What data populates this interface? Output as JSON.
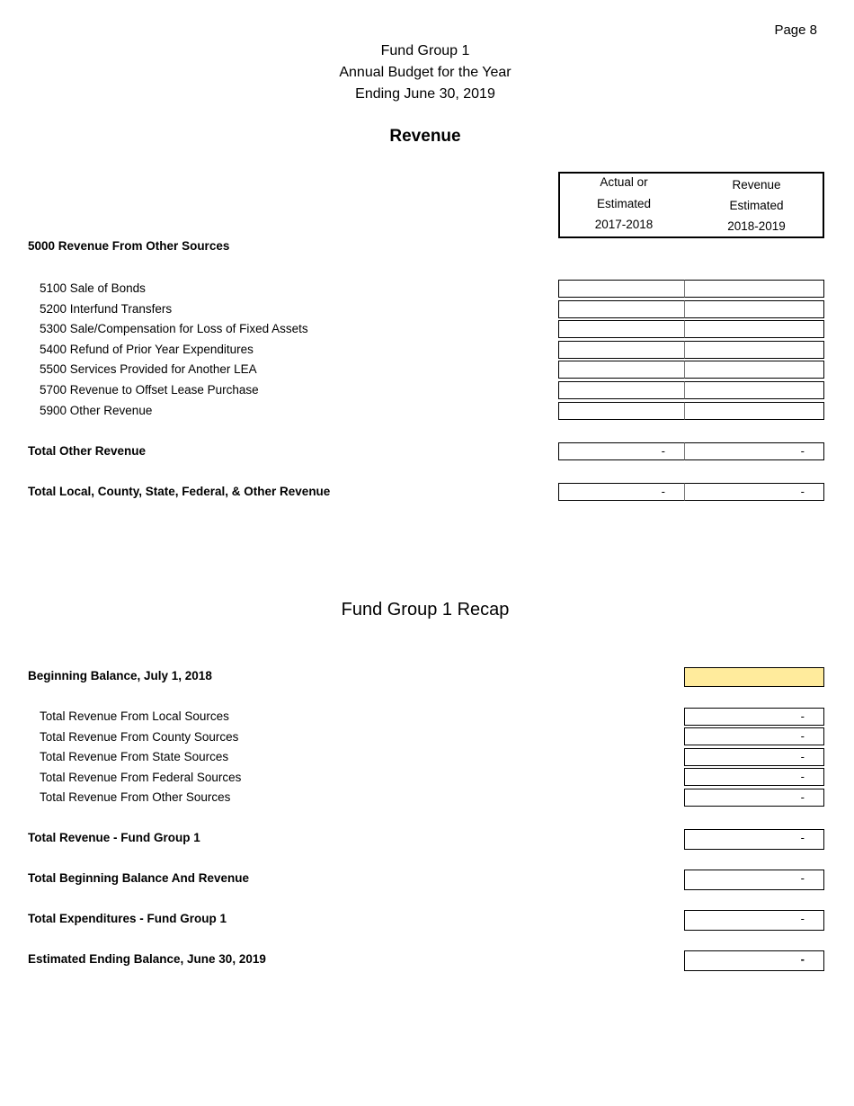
{
  "page_label": "Page 8",
  "header": {
    "line1": "Fund Group 1",
    "line2": "Annual Budget for the Year",
    "line3": "Ending June 30, 2019"
  },
  "revenue": {
    "title": "Revenue",
    "columns": [
      {
        "lines": [
          "Actual or",
          "Estimated",
          "2017-2018"
        ]
      },
      {
        "lines": [
          "Revenue",
          "Estimated",
          "2018-2019"
        ]
      }
    ],
    "section_heading": "5000 Revenue From Other Sources",
    "items": [
      {
        "label": "5100 Sale of Bonds",
        "actual": "",
        "estimated": ""
      },
      {
        "label": "5200 Interfund Transfers",
        "actual": "",
        "estimated": ""
      },
      {
        "label": "5300 Sale/Compensation for Loss of Fixed Assets",
        "actual": "",
        "estimated": ""
      },
      {
        "label": "5400 Refund of Prior Year Expenditures",
        "actual": "",
        "estimated": ""
      },
      {
        "label": "5500 Services Provided for Another LEA",
        "actual": "",
        "estimated": ""
      },
      {
        "label": "5700 Revenue to Offset Lease Purchase",
        "actual": "",
        "estimated": ""
      },
      {
        "label": "5900 Other Revenue",
        "actual": "",
        "estimated": ""
      }
    ],
    "total_other": {
      "label": "Total Other Revenue",
      "actual": "-",
      "estimated": "-"
    },
    "total_all": {
      "label": "Total Local, County, State, Federal, & Other Revenue",
      "actual": "-",
      "estimated": "-"
    }
  },
  "recap": {
    "title": "Fund Group 1 Recap",
    "beginning_balance": {
      "label": "Beginning Balance, July 1, 2018",
      "value": "",
      "highlight_color": "#ffeb9c"
    },
    "sources": [
      {
        "label": "Total Revenue From Local Sources",
        "value": "-"
      },
      {
        "label": "Total Revenue From County Sources",
        "value": "-"
      },
      {
        "label": "Total Revenue From State Sources",
        "value": "-"
      },
      {
        "label": "Total Revenue From Federal Sources",
        "value": "-"
      },
      {
        "label": "Total Revenue From Other Sources",
        "value": "-"
      }
    ],
    "total_revenue": {
      "label": "Total Revenue - Fund Group 1",
      "value": "-"
    },
    "total_beginning_and_revenue": {
      "label": "Total Beginning Balance And Revenue",
      "value": "-"
    },
    "total_expenditures": {
      "label": "Total Expenditures - Fund Group 1",
      "value": "-"
    },
    "ending_balance": {
      "label": "Estimated Ending Balance, June 30, 2019",
      "value": "-"
    }
  }
}
